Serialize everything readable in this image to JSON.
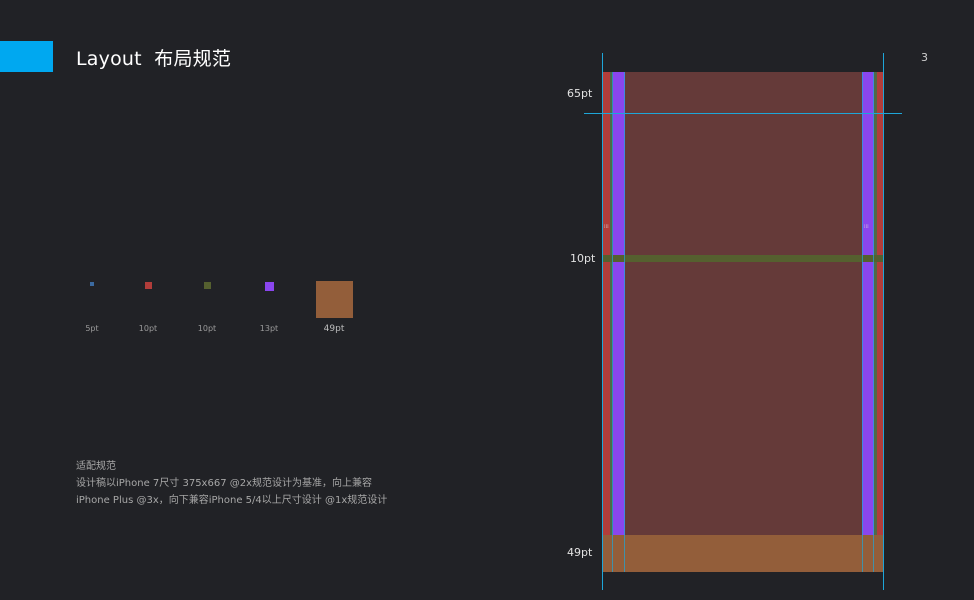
{
  "header": {
    "title": "Layout  布局规范",
    "page_number": "3",
    "accent_color": "#00a8f0"
  },
  "swatches": [
    {
      "label": "5pt",
      "color": "#3b6aa0"
    },
    {
      "label": "10pt",
      "color": "#b13d3a"
    },
    {
      "label": "10pt",
      "color": "#55602f"
    },
    {
      "label": "13pt",
      "color": "#8a46ee"
    },
    {
      "label": "49pt",
      "color": "#935e3a"
    }
  ],
  "notes": {
    "heading": "适配规范",
    "line1": "设计稿以iPhone 7尺寸 375x667 @2x规范设计为基准，向上兼容",
    "line2": "iPhone Plus @3x，向下兼容iPhone 5/4以上尺寸设计 @1x规范设计"
  },
  "diagram": {
    "nav_height_label": "65pt",
    "gap_label": "10pt",
    "tabbar_label": "49pt",
    "colors": {
      "content": "#653a39",
      "margin": "#b13d3a",
      "gutter": "#8a46ee",
      "gap": "#55602f",
      "tabbar": "#935e3a",
      "guide": "#1ea6d8"
    }
  }
}
